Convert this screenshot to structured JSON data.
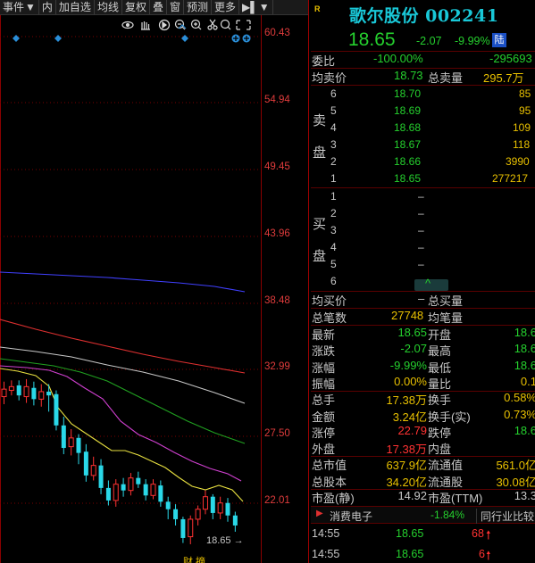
{
  "toolbar": {
    "items": [
      "事件",
      "内",
      "加自选",
      "均线",
      "复权",
      "叠",
      "窗",
      "预测",
      "更多"
    ]
  },
  "chart": {
    "price_levels": [
      "60.43",
      "54.94",
      "49.45",
      "43.96",
      "38.48",
      "32.99",
      "27.50",
      "22.01"
    ],
    "last_price_label": "18.65 →",
    "bottom_marks": "财          摘",
    "colors": {
      "up": "#ff3232",
      "down": "#2ad8e8",
      "ma_blue": "#4040ff",
      "ma_red": "#e03030",
      "ma_green": "#20a020",
      "ma_purple": "#d040d0",
      "ma_yellow": "#e8e040",
      "ma_white": "#ffffff"
    }
  },
  "chart_data": {
    "type": "candlestick",
    "ylim": [
      19.3,
      63.1
    ],
    "price_levels": [
      60.43,
      54.94,
      49.45,
      43.96,
      38.48,
      32.99,
      27.5,
      22.01
    ],
    "candles": [
      {
        "o": 32.6,
        "c": 33.2,
        "h": 33.8,
        "l": 32.0
      },
      {
        "o": 33.1,
        "c": 33.4,
        "h": 33.9,
        "l": 32.7
      },
      {
        "o": 33.5,
        "c": 32.7,
        "h": 33.9,
        "l": 32.3
      },
      {
        "o": 32.6,
        "c": 33.4,
        "h": 34.0,
        "l": 32.1
      },
      {
        "o": 33.3,
        "c": 32.4,
        "h": 33.8,
        "l": 31.9
      },
      {
        "o": 32.4,
        "c": 33.0,
        "h": 33.6,
        "l": 31.8
      },
      {
        "o": 33.0,
        "c": 32.7,
        "h": 33.6,
        "l": 31.4
      },
      {
        "o": 32.8,
        "c": 30.3,
        "h": 33.1,
        "l": 29.9
      },
      {
        "o": 30.3,
        "c": 28.5,
        "h": 31.0,
        "l": 28.0
      },
      {
        "o": 28.6,
        "c": 29.3,
        "h": 30.0,
        "l": 27.9
      },
      {
        "o": 29.3,
        "c": 28.1,
        "h": 29.6,
        "l": 27.2
      },
      {
        "o": 28.2,
        "c": 26.3,
        "h": 28.8,
        "l": 25.8
      },
      {
        "o": 26.3,
        "c": 27.1,
        "h": 27.8,
        "l": 25.9
      },
      {
        "o": 27.1,
        "c": 25.3,
        "h": 27.6,
        "l": 24.8
      },
      {
        "o": 25.3,
        "c": 24.3,
        "h": 25.9,
        "l": 23.9
      },
      {
        "o": 24.3,
        "c": 25.6,
        "h": 26.0,
        "l": 23.8
      },
      {
        "o": 25.6,
        "c": 25.1,
        "h": 26.1,
        "l": 24.6
      },
      {
        "o": 25.1,
        "c": 26.1,
        "h": 26.5,
        "l": 24.7
      },
      {
        "o": 26.1,
        "c": 25.6,
        "h": 26.6,
        "l": 25.3
      },
      {
        "o": 25.6,
        "c": 24.7,
        "h": 26.0,
        "l": 24.3
      },
      {
        "o": 24.7,
        "c": 25.6,
        "h": 26.0,
        "l": 24.4
      },
      {
        "o": 25.5,
        "c": 24.2,
        "h": 25.9,
        "l": 23.8
      },
      {
        "o": 24.2,
        "c": 23.6,
        "h": 24.6,
        "l": 22.8
      },
      {
        "o": 23.6,
        "c": 22.8,
        "h": 24.0,
        "l": 22.3
      },
      {
        "o": 22.8,
        "c": 21.3,
        "h": 23.0,
        "l": 20.9
      },
      {
        "o": 21.4,
        "c": 22.8,
        "h": 23.1,
        "l": 20.8
      },
      {
        "o": 22.8,
        "c": 23.6,
        "h": 23.9,
        "l": 22.3
      },
      {
        "o": 23.6,
        "c": 24.6,
        "h": 25.1,
        "l": 23.2
      },
      {
        "o": 24.6,
        "c": 23.3,
        "h": 24.8,
        "l": 22.8
      },
      {
        "o": 23.3,
        "c": 24.1,
        "h": 24.6,
        "l": 22.8
      },
      {
        "o": 24.1,
        "c": 23.1,
        "h": 24.5,
        "l": 22.6
      },
      {
        "o": 23.1,
        "c": 22.3,
        "h": 23.4,
        "l": 21.8
      }
    ]
  },
  "quote": {
    "r_badge": "R",
    "name_code": "歌尔股份 002241",
    "price": "18.65",
    "change": "-2.07",
    "change_pct": "-9.99%",
    "badge": "陆",
    "weibi_label": "委比",
    "weibi": "-100.00%",
    "weicha": "-295693",
    "avg_sell_label": "均卖价",
    "avg_sell": "18.73",
    "total_sell_label": "总卖量",
    "total_sell": "295.7万",
    "sell_side_label": [
      "卖",
      "盘"
    ],
    "sells": [
      {
        "lvl": "6",
        "price": "18.70",
        "vol": "85"
      },
      {
        "lvl": "5",
        "price": "18.69",
        "vol": "95"
      },
      {
        "lvl": "4",
        "price": "18.68",
        "vol": "109"
      },
      {
        "lvl": "3",
        "price": "18.67",
        "vol": "118"
      },
      {
        "lvl": "2",
        "price": "18.66",
        "vol": "3990"
      },
      {
        "lvl": "1",
        "price": "18.65",
        "vol": "277217"
      }
    ],
    "buy_side_label": [
      "买",
      "盘"
    ],
    "buys": [
      {
        "lvl": "1",
        "price": "–"
      },
      {
        "lvl": "2",
        "price": "–"
      },
      {
        "lvl": "3",
        "price": "–"
      },
      {
        "lvl": "4",
        "price": "–"
      },
      {
        "lvl": "5",
        "price": "–"
      },
      {
        "lvl": "6",
        "price": ""
      }
    ],
    "caret": "^",
    "avg_buy_label": "均买价",
    "avg_buy": "–",
    "total_buy_label": "总买量",
    "total_deals_label": "总笔数",
    "total_deals": "27748",
    "avg_deal_label": "均笔量",
    "stats": [
      {
        "l1": "最新",
        "v1": "18.65",
        "c1": "green",
        "l2": "开盘",
        "v2": "18.6",
        "c2": "green"
      },
      {
        "l1": "涨跌",
        "v1": "-2.07",
        "c1": "green",
        "l2": "最高",
        "v2": "18.6",
        "c2": "green"
      },
      {
        "l1": "涨幅",
        "v1": "-9.99%",
        "c1": "green",
        "l2": "最低",
        "v2": "18.6",
        "c2": "green"
      },
      {
        "l1": "振幅",
        "v1": "0.00%",
        "c1": "yellow",
        "l2": "量比",
        "v2": "0.1",
        "c2": "yellow"
      },
      {
        "l1": "总手",
        "v1": "17.38万",
        "c1": "yellow",
        "l2": "换手",
        "v2": "0.58%",
        "c2": "yellow"
      },
      {
        "l1": "金额",
        "v1": "3.24亿",
        "c1": "yellow",
        "l2": "换手(实)",
        "v2": "0.73%",
        "c2": "yellow"
      },
      {
        "l1": "涨停",
        "v1": "22.79",
        "c1": "red",
        "l2": "跌停",
        "v2": "18.6",
        "c2": "green"
      },
      {
        "l1": "外盘",
        "v1": "17.38万",
        "c1": "red",
        "l2": "内盘",
        "v2": "",
        "c2": "green"
      },
      {
        "l1": "总市值",
        "v1": "637.9亿",
        "c1": "yellow",
        "l2": "流通值",
        "v2": "561.0亿",
        "c2": "yellow"
      },
      {
        "l1": "总股本",
        "v1": "34.20亿",
        "c1": "yellow",
        "l2": "流通股",
        "v2": "30.08亿",
        "c2": "yellow"
      },
      {
        "l1": "市盈(静)",
        "v1": "14.92",
        "c1": "white",
        "l2": "市盈(TTM)",
        "v2": "13.3",
        "c2": "white"
      }
    ],
    "sector": {
      "name": "消费电子",
      "pct": "-1.84%",
      "button": "同行业比较"
    },
    "ticks": [
      {
        "time": "14:55",
        "price": "18.65",
        "vol": "68"
      },
      {
        "time": "14:55",
        "price": "18.65",
        "vol": "6"
      }
    ]
  }
}
